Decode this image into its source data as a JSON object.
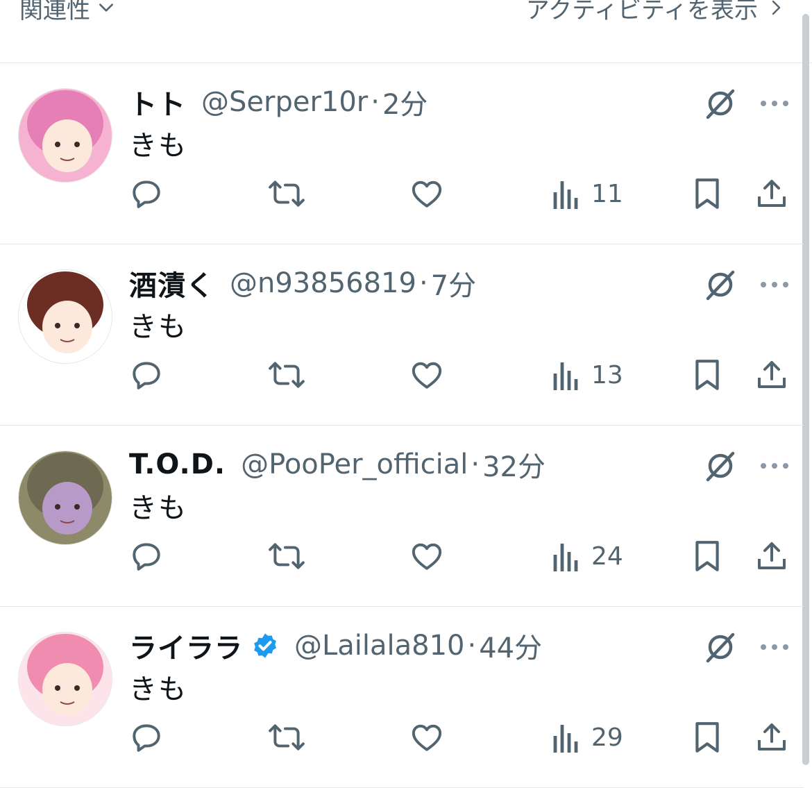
{
  "header": {
    "sort_label": "関連性",
    "activity_label": "アクティビティを表示"
  },
  "tweets": [
    {
      "name": "トト",
      "handle": "@Serper10r",
      "time": "2分",
      "text": "きも",
      "verified": false,
      "views": "11",
      "avatar_colors": [
        "#f6b3d1",
        "#e57fb5",
        "#b67ad8"
      ]
    },
    {
      "name": "酒漬く",
      "handle": "@n93856819",
      "time": "7分",
      "text": "きも",
      "verified": false,
      "views": "13",
      "avatar_colors": [
        "#ffffff",
        "#6b2d24",
        "#202a44"
      ]
    },
    {
      "name": "T.O.D.",
      "handle": "@PooPer_official",
      "time": "32分",
      "text": "きも",
      "verified": false,
      "views": "24",
      "avatar_colors": [
        "#8d8a6a",
        "#b89ac8",
        "#6e6a52"
      ]
    },
    {
      "name": "ライララ",
      "handle": "@Lailala810",
      "time": "44分",
      "text": "きも",
      "verified": true,
      "views": "29",
      "avatar_colors": [
        "#fde3ea",
        "#f08cb0",
        "#ffffff"
      ]
    }
  ],
  "icons": {
    "reply": "reply-icon",
    "retweet": "retweet-icon",
    "like": "like-icon",
    "views": "views-icon",
    "bookmark": "bookmark-icon",
    "share": "share-icon",
    "grok": "grok-icon",
    "more": "more-icon",
    "verified": "verified-badge-icon"
  },
  "colors": {
    "text_primary": "#0f1419",
    "text_secondary": "#536471",
    "verified_blue": "#1d9bf0",
    "divider": "#e3e6ea"
  }
}
